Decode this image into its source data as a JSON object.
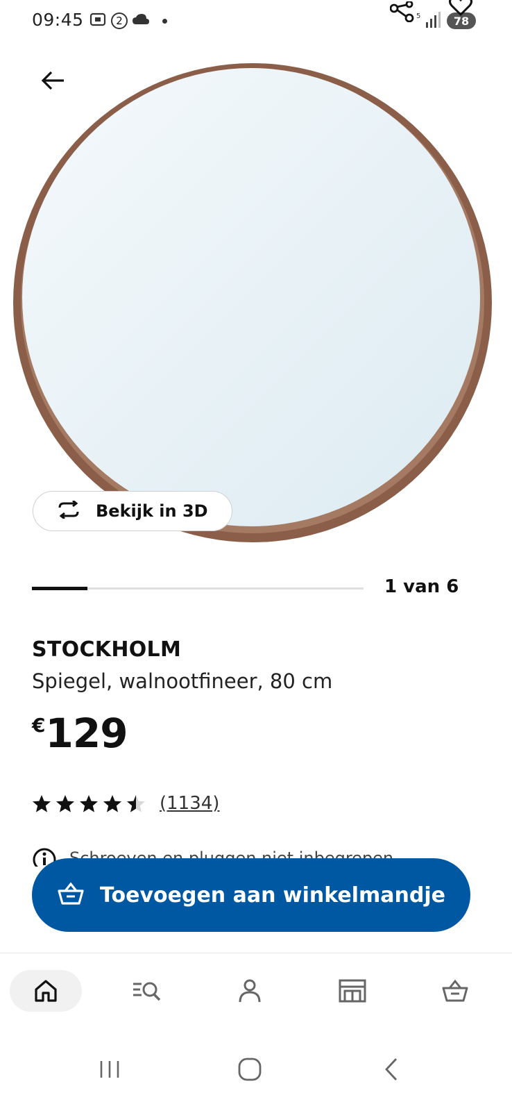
{
  "status_bar": {
    "time": "09:45",
    "sim_number": "2",
    "battery": "78"
  },
  "product": {
    "view_3d_label": "Bekijk in 3D",
    "image_progress": {
      "current": 1,
      "total": 6,
      "label": "1 van 6"
    },
    "name": "STOCKHOLM",
    "description": "Spiegel, walnootfineer, 80 cm",
    "price_currency": "€",
    "price_value": "129",
    "rating": 4.5,
    "review_count": "(1134)",
    "info_text": "Schroeven en pluggen niet inbegrepen"
  },
  "cart_button": {
    "label": "Toevoegen aan winkelmandje"
  },
  "bottom_nav": {
    "items": [
      {
        "icon": "home-icon",
        "active": true
      },
      {
        "icon": "search-list-icon",
        "active": false
      },
      {
        "icon": "profile-icon",
        "active": false
      },
      {
        "icon": "store-icon",
        "active": false
      },
      {
        "icon": "basket-icon",
        "active": false
      }
    ]
  },
  "colors": {
    "accent": "#0058a3",
    "mirror_frame": "#8a5e48",
    "mirror_glass": "#e6f1f6"
  }
}
